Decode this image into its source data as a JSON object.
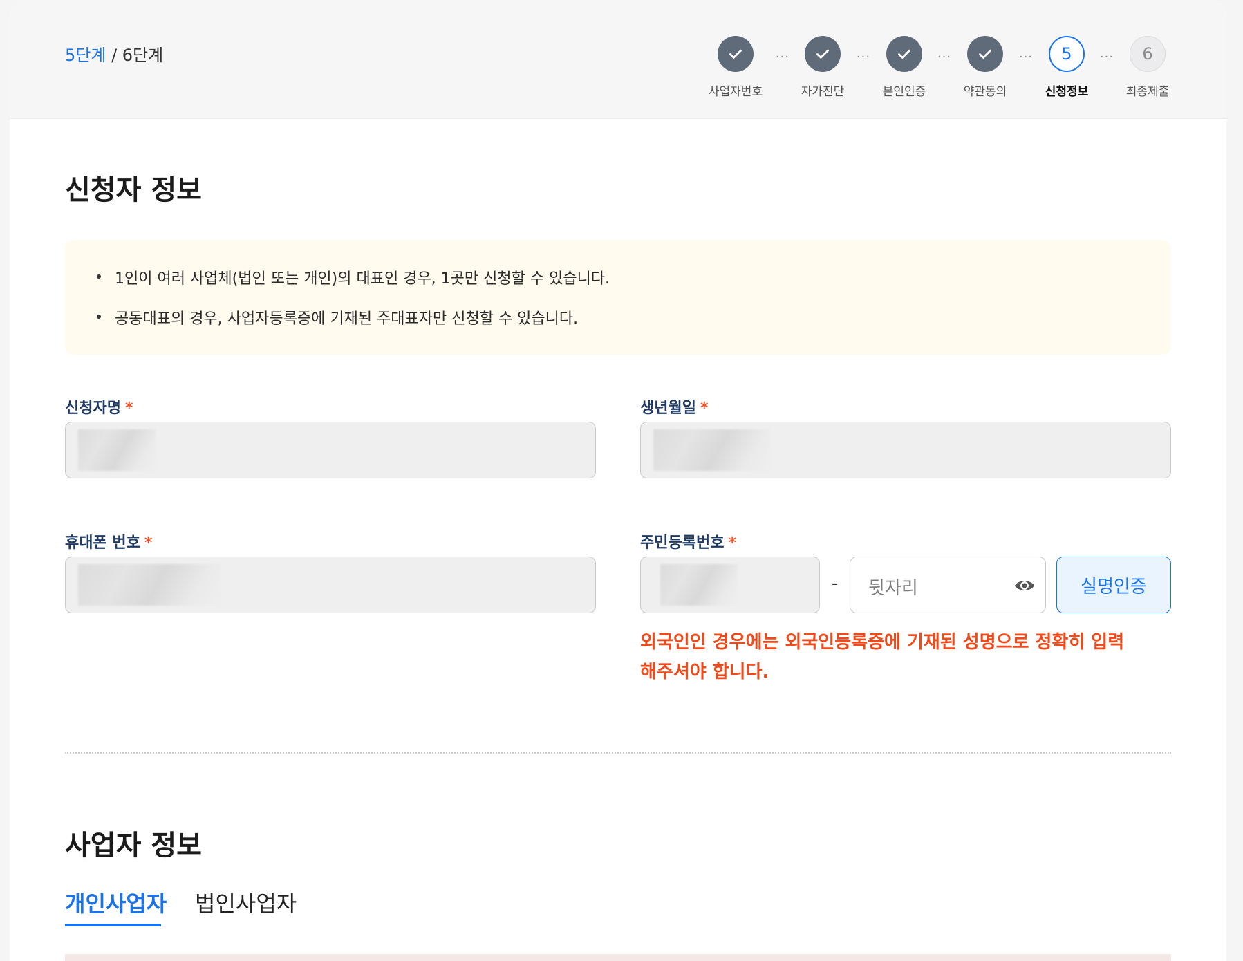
{
  "step_counter": {
    "current": "5단계",
    "total": " / 6단계"
  },
  "stepper": {
    "steps": [
      {
        "label": "사업자번호",
        "state": "done",
        "icon": "check-icon"
      },
      {
        "label": "자가진단",
        "state": "done",
        "icon": "check-icon"
      },
      {
        "label": "본인인증",
        "state": "done",
        "icon": "check-icon"
      },
      {
        "label": "약관동의",
        "state": "done",
        "icon": "check-icon"
      },
      {
        "label": "신청정보",
        "state": "active",
        "number": "5"
      },
      {
        "label": "최종제출",
        "state": "todo",
        "number": "6"
      }
    ],
    "separator": "···"
  },
  "applicant": {
    "title": "신청자 정보",
    "notices": [
      "1인이 여러 사업체(법인 또는 개인)의 대표인 경우, 1곳만 신청할 수 있습니다.",
      "공동대표의 경우, 사업자등록증에 기재된 주대표자만 신청할 수 있습니다."
    ],
    "name_label": "신청자명",
    "birth_label": "생년월일",
    "phone_label": "휴대폰 번호",
    "rrn_label": "주민등록번호",
    "required_mark": "*",
    "rrn_dash": "-",
    "rrn_back_placeholder": "뒷자리",
    "verify_button": "실명인증",
    "warning": "외국인인 경우에는 외국인등록증에 기재된 성명으로 정확히 입력해주셔야 합니다."
  },
  "business": {
    "title": "사업자 정보",
    "tabs": [
      {
        "label": "개인사업자",
        "active": true
      },
      {
        "label": "법인사업자",
        "active": false
      }
    ]
  },
  "colors": {
    "accent": "#1a73e8",
    "warning": "#f04a1a",
    "label": "#1f3b63",
    "done_step": "#5f6b78"
  }
}
